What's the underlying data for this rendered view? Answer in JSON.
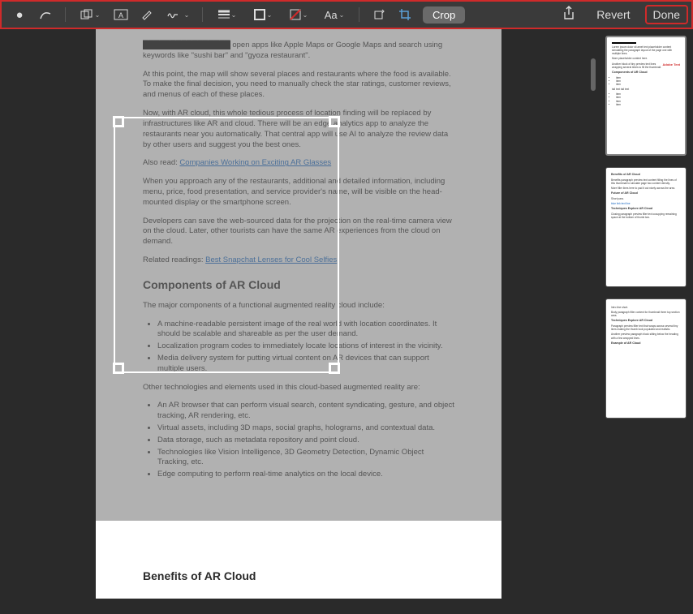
{
  "toolbar": {
    "tools": {
      "point": "●",
      "pen": "✎",
      "shapes": "▢",
      "textbox": "A",
      "highlight": "✎",
      "sign": "Sgn",
      "list": "≡",
      "border": "▢",
      "fill": "▨",
      "font": "Aa",
      "rotate": "⟳",
      "cropicon": "✂"
    },
    "crop_label": "Crop",
    "revert": "Revert",
    "done": "Done",
    "share": "↥"
  },
  "doc": {
    "p1a": "open apps like Apple Maps or Google Maps and search using keywords like \"sushi bar\" and \"gyoza restaurant\".",
    "p1b": "At this point, the map will show several places and restaurants where the food is available. To make the final decision, you need to manually check the star ratings, customer reviews, and menus of each of these places.",
    "p1c": "Now, with AR cloud, this whole tedious process of location finding will be replaced by infrastructures like AR and cloud. There will be an edge analytics app to analyze the restaurants near you automatically. That central app will use AI to analyze the review data by other users and suggest you the best ones.",
    "also_read": "Also read: ",
    "link1": "Companies Working on Exciting AR Glasses",
    "p1d": "When you approach any of the restaurants, additional and detailed information, including menu, price, food presentation, and service provider's name, will be visible on the head-mounted display or the smartphone screen.",
    "p1e": "Developers can save the web-sourced data for the projection on the real-time camera view on the cloud. Later, other tourists can have the same AR experiences from the cloud on demand.",
    "related": "Related readings: ",
    "link2": "Best Snapchat Lenses for Cool Selfies",
    "h_components": "Components of AR Cloud",
    "p2a": "The major components of a functional augmented reality cloud include:",
    "list_a": [
      "A machine-readable persistent image of the real world with location coordinates. It should be scalable and shareable as per the user demand.",
      "Localization program codes to immediately locate locations of interest in the vicinity.",
      "Media delivery system for putting virtual content on AR devices that can support multiple users."
    ],
    "p2b": "Other technologies and elements used in this cloud-based augmented reality are:",
    "list_b": [
      "An AR browser that can perform visual search, content syndicating, gesture, and object tracking, AR rendering, etc.",
      "Virtual assets, including 3D maps, social graphs, holograms, and contextual data.",
      "Data storage, such as metadata repository and point cloud.",
      "Technologies like Vision Intelligence, 3D Geometry Detection, Dynamic Object Tracking, etc.",
      "Edge computing to perform real-time analytics on the local device."
    ],
    "h_benefits": "Benefits of AR Cloud"
  },
  "thumbs": {
    "t1": {
      "adobe": "Adobe Text",
      "h": "Components of AR Cloud"
    },
    "t2": {
      "h1": "Benefits of AR Cloud",
      "h2": "Future of AR Cloud",
      "h3": "Techniques Explore AR Cloud"
    },
    "t3": {
      "h1": "Techniques Explore AR Cloud",
      "h2": "Example of AR Cloud"
    }
  }
}
